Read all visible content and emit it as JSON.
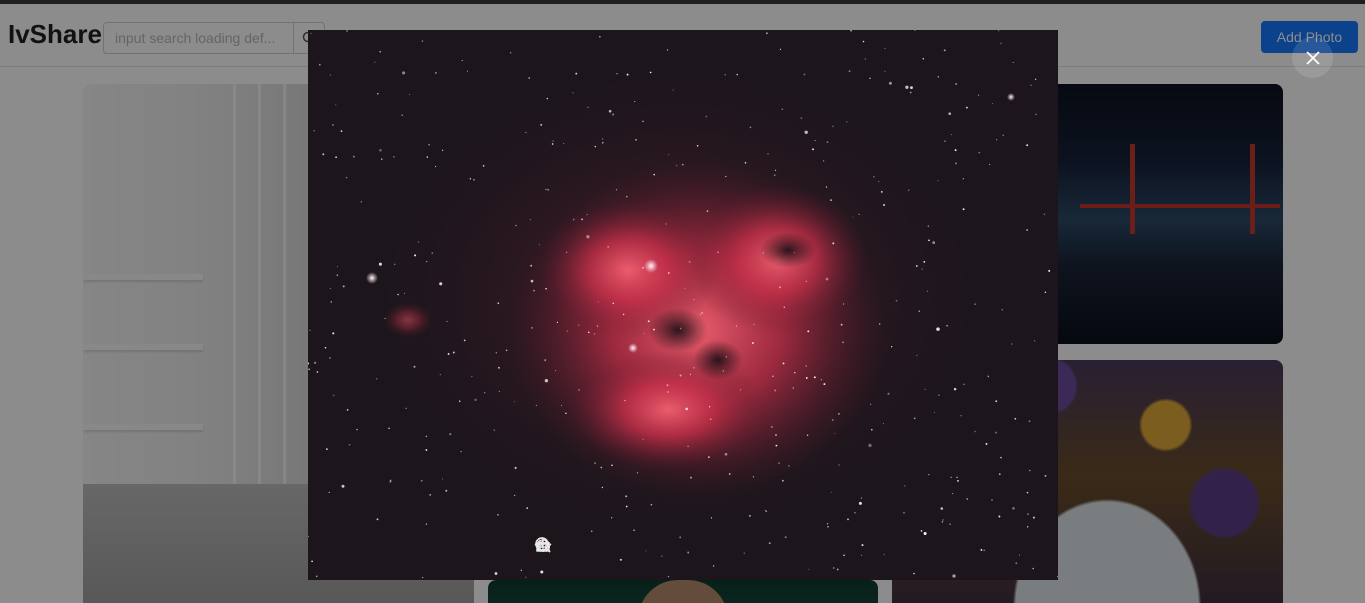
{
  "header": {
    "brand": "IvShare",
    "search_placeholder": "input search loading def...",
    "search_icon": "search-icon",
    "add_photo_label": "Add Photo"
  },
  "gallery": {
    "photos": [
      {
        "subject": "white-architecture-interior"
      },
      {
        "subject": "car-dashboard-golden-gate-bridge"
      },
      {
        "subject": "flower-arch"
      },
      {
        "subject": "portrait"
      }
    ]
  },
  "viewer": {
    "image_subject": "red-nebula-starfield",
    "close_icon": "close-icon",
    "toolbar": [
      {
        "icon": "flip-vertical-icon"
      },
      {
        "icon": "flip-horizontal-icon"
      },
      {
        "icon": "rotate-left-icon"
      },
      {
        "icon": "rotate-right-icon"
      },
      {
        "icon": "zoom-out-icon"
      },
      {
        "icon": "zoom-in-icon"
      }
    ]
  },
  "colors": {
    "accent": "#1677ff",
    "overlay": "rgba(0,0,0,0.45)",
    "nebula": "#d83a52"
  }
}
